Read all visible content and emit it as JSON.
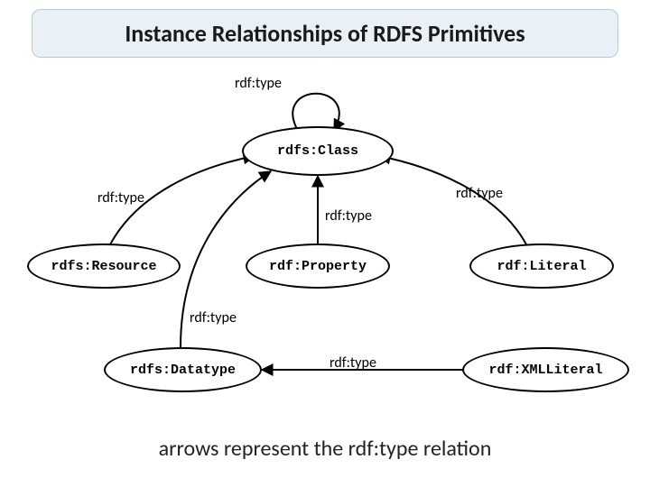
{
  "title": "Instance Relationships of RDFS Primitives",
  "caption": "arrows represent the rdf:type relation",
  "edge_label": "rdf:type",
  "nodes": {
    "class": "rdfs:Class",
    "resource": "rdfs:Resource",
    "property": "rdf:Property",
    "literal": "rdf:Literal",
    "datatype": "rdfs:Datatype",
    "xmlliteral": "rdf:XMLLiteral"
  },
  "labels": {
    "selfloop": "rdf:type",
    "resource_to_class": "rdf:type",
    "literal_to_class": "rdf:type",
    "property_to_class": "rdf:type",
    "datatype_to_class": "rdf:type",
    "xmlliteral_to_datatype": "rdf:type"
  }
}
